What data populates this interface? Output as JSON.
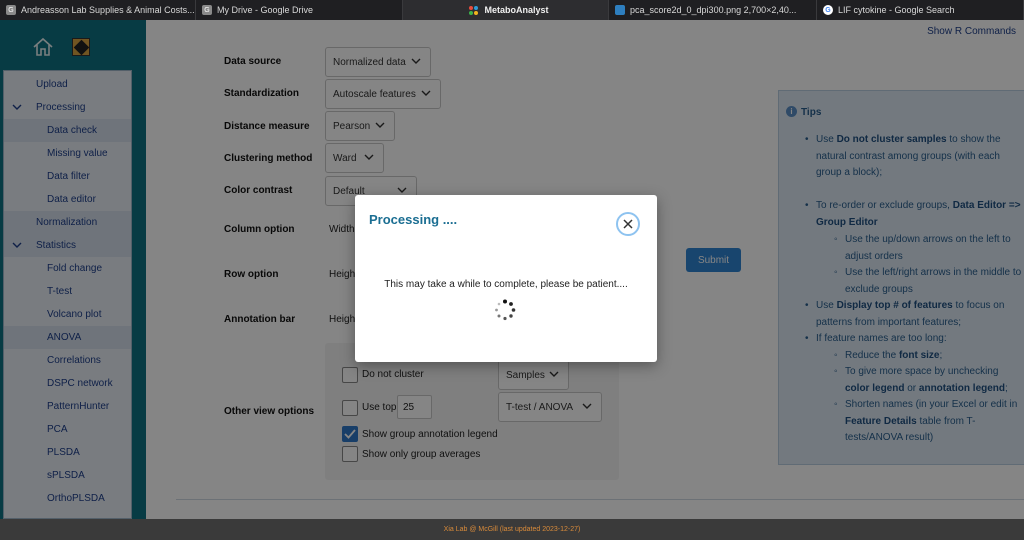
{
  "browser": {
    "tabs": [
      {
        "title": "Andreasson Lab Supplies & Animal Costs...",
        "favicon": "G"
      },
      {
        "title": "My Drive - Google Drive",
        "favicon": "G"
      },
      {
        "title": "MetaboAnalyst",
        "favicon": "metaboanalyst-icon"
      },
      {
        "title": "pca_score2d_0_dpi300.png 2,700×2,40...",
        "favicon": "image-icon"
      },
      {
        "title": "LIF cytokine - Google Search",
        "favicon": "G"
      }
    ]
  },
  "sidebar": {
    "items": [
      {
        "label": "Upload"
      },
      {
        "label": "Processing"
      },
      {
        "label": "Data check"
      },
      {
        "label": "Missing value"
      },
      {
        "label": "Data filter"
      },
      {
        "label": "Data editor"
      },
      {
        "label": "Normalization"
      },
      {
        "label": "Statistics"
      },
      {
        "label": "Fold change"
      },
      {
        "label": "T-test"
      },
      {
        "label": "Volcano plot"
      },
      {
        "label": "ANOVA"
      },
      {
        "label": "Correlations"
      },
      {
        "label": "DSPC network"
      },
      {
        "label": "PatternHunter"
      },
      {
        "label": "PCA"
      },
      {
        "label": "PLSDA"
      },
      {
        "label": "sPLSDA"
      },
      {
        "label": "OrthoPLSDA"
      }
    ]
  },
  "header": {
    "show_r_commands": "Show R Commands"
  },
  "form": {
    "data_source": {
      "label": "Data source",
      "value": "Normalized data"
    },
    "standardization": {
      "label": "Standardization",
      "value": "Autoscale features"
    },
    "distance_measure": {
      "label": "Distance measure",
      "value": "Pearson"
    },
    "clustering_method": {
      "label": "Clustering method",
      "value": "Ward"
    },
    "color_contrast": {
      "label": "Color contrast",
      "value": "Default"
    },
    "column_option": {
      "label": "Column option",
      "value_stub": "Width"
    },
    "row_option": {
      "label": "Row option",
      "value_stub": "Heigh"
    },
    "annotation_bar": {
      "label": "Annotation bar",
      "value_stub": "Heigh"
    },
    "other_view_options": {
      "label": "Other view options"
    },
    "submit_label": "Submit",
    "options": {
      "do_not_cluster": {
        "label": "Do not cluster",
        "checked": false,
        "select": "Samples"
      },
      "use_top": {
        "label": "Use top",
        "checked": false,
        "number": "25",
        "select": "T-test / ANOVA"
      },
      "show_group_annotation_legend": {
        "label": "Show group annotation legend",
        "checked": true
      },
      "show_only_group_averages": {
        "label": "Show only group averages",
        "checked": false
      }
    }
  },
  "tips": {
    "title": "Tips",
    "items": [
      {
        "pre": "Use ",
        "bold": "Do not cluster samples",
        "post": " to show the natural contrast among groups (with each group a block);"
      },
      {
        "pre": "To re-order or exclude groups, ",
        "bold": "Data Editor => Group Editor",
        "post": ""
      },
      {
        "pre": "Use the up/down arrows on the left to adjust orders",
        "bold": "",
        "post": ""
      },
      {
        "pre": "Use the left/right arrows in the middle to exclude groups",
        "bold": "",
        "post": ""
      },
      {
        "pre": "Use ",
        "bold": "Display top # of features",
        "post": " to focus on patterns from important features;"
      },
      {
        "pre": "If feature names are too long:",
        "bold": "",
        "post": ""
      },
      {
        "pre": "Reduce the ",
        "bold": "font size",
        "post": ";"
      },
      {
        "pre": "To give more space by unchecking ",
        "bold": "color legend",
        "post": " or ",
        "bold2": "annotation legend",
        "post2": ";"
      },
      {
        "pre": "Shorten names (in your Excel or edit in ",
        "bold": "Feature Details",
        "post": " table from T-tests/ANOVA result)"
      }
    ]
  },
  "modal": {
    "title": "Processing ....",
    "message": "This may take a while to complete, please be patient...."
  },
  "footer": {
    "text": "Xia Lab @ McGill   (last updated 2023-12-27)"
  },
  "colors": {
    "teal_frame": "#0f7282",
    "accent_blue": "#2f84d3",
    "link_blue": "#1e3f8a",
    "footer_orange": "#d98b3a"
  }
}
